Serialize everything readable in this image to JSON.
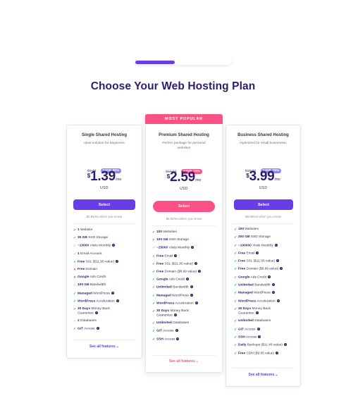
{
  "page_title": "Choose Your Web Hosting Plan",
  "plans": [
    {
      "name": "Single Shared Hosting",
      "description": "Ideal solution for beginners",
      "old_price": "$9.49",
      "save_badge": "SAVE 85%",
      "currency": "$",
      "price": "1.39",
      "per": "/mo",
      "currency_code": "USD",
      "select_label": "Select",
      "renew_text": "$2.99/mo when you renew",
      "see_all_label": "See all features",
      "features": [
        {
          "mark": "check",
          "bold": "1",
          "text": " Website",
          "info": false
        },
        {
          "mark": "check",
          "bold": "30 GB",
          "text": " SSD Storage",
          "info": false
        },
        {
          "mark": "warn",
          "bold": "~10000",
          "text": " Visits Monthly",
          "info": true
        },
        {
          "mark": "warn",
          "bold": "1",
          "text": " Email Account",
          "info": false
        },
        {
          "mark": "check",
          "bold": "Free",
          "text": " SSL ($11.95 value)",
          "info": true
        },
        {
          "mark": "cross",
          "bold": "Free",
          "text": " Domain",
          "info": false
        },
        {
          "mark": "cross",
          "bold": "Google",
          "text": " Ads Credit",
          "info": false
        },
        {
          "mark": "warn",
          "bold": "100 GB",
          "text": " Bandwidth",
          "info": false
        },
        {
          "mark": "check",
          "bold": "Managed",
          "text": " WordPress",
          "info": true
        },
        {
          "mark": "check",
          "bold": "WordPress",
          "text": " Acceleration",
          "info": true
        },
        {
          "mark": "check",
          "bold": "30 Days",
          "text": " Money Back",
          "text2": "Guarantee",
          "info": true
        },
        {
          "mark": "warn",
          "bold": "2",
          "text": " Databases",
          "info": false
        },
        {
          "mark": "check",
          "bold": "GIT",
          "text": " Access",
          "info": true
        }
      ]
    },
    {
      "ribbon": "MOST POPULAR",
      "name": "Premium Shared Hosting",
      "description": "Perfect package for personal websites",
      "old_price": "$10.59",
      "save_badge": "SAVE 75%",
      "currency": "$",
      "price": "2.59",
      "per": "/mo",
      "currency_code": "USD",
      "select_label": "Select",
      "renew_text": "$5.99/mo when you renew",
      "see_all_label": "See all features",
      "features": [
        {
          "mark": "check",
          "bold": "100",
          "text": " Websites",
          "info": false
        },
        {
          "mark": "check",
          "bold": "100 GB",
          "text": " SSD Storage",
          "info": false
        },
        {
          "mark": "warn",
          "bold": "~25000",
          "text": " Visits Monthly",
          "info": true
        },
        {
          "mark": "check",
          "bold": "Free",
          "text": " Email",
          "info": true
        },
        {
          "mark": "check",
          "bold": "Free",
          "text": " SSL ($11.95 value)",
          "info": true
        },
        {
          "mark": "check",
          "bold": "Free",
          "text": " Domain ($8.99 value)",
          "info": true
        },
        {
          "mark": "check",
          "bold": "Google",
          "text": " Ads Credit",
          "info": true
        },
        {
          "mark": "check",
          "bold": "Unlimited",
          "text": " Bandwidth",
          "info": true
        },
        {
          "mark": "check",
          "bold": "Managed",
          "text": " WordPress",
          "info": true
        },
        {
          "mark": "check",
          "bold": "WordPress",
          "text": " Acceleration",
          "info": true
        },
        {
          "mark": "check",
          "bold": "30 Days",
          "text": " Money Back",
          "text2": "Guarantee",
          "info": true
        },
        {
          "mark": "check",
          "bold": "Unlimited",
          "text": " Databases",
          "info": false
        },
        {
          "mark": "check",
          "bold": "GIT",
          "text": " Access",
          "info": true
        },
        {
          "mark": "check",
          "bold": "SSH",
          "text": " Access",
          "info": true
        }
      ]
    },
    {
      "name": "Business Shared Hosting",
      "description": "Optimized for small businesses",
      "old_price": "$18.99",
      "save_badge": "SAVE 75%",
      "currency": "$",
      "price": "3.99",
      "per": "/mo",
      "currency_code": "USD",
      "select_label": "Select",
      "renew_text": "$8.99/mo when you renew",
      "see_all_label": "See all features",
      "features": [
        {
          "mark": "check",
          "bold": "100",
          "text": " Websites",
          "info": false
        },
        {
          "mark": "check",
          "bold": "200 GB",
          "text": " SSD Storage",
          "info": false
        },
        {
          "mark": "check",
          "bold": "~100000",
          "text": " Visits Monthly",
          "info": true
        },
        {
          "mark": "check",
          "bold": "Free",
          "text": " Email",
          "info": true
        },
        {
          "mark": "check",
          "bold": "Free",
          "text": " SSL ($11.95 value)",
          "info": true
        },
        {
          "mark": "check",
          "bold": "Free",
          "text": " Domain ($8.99 value)",
          "info": true
        },
        {
          "mark": "check",
          "bold": "Google",
          "text": " Ads Credit",
          "info": true
        },
        {
          "mark": "check",
          "bold": "Unlimited",
          "text": " Bandwidth",
          "info": true
        },
        {
          "mark": "check",
          "bold": "Managed",
          "text": " WordPress",
          "info": true
        },
        {
          "mark": "check",
          "bold": "WordPress",
          "text": " Acceleration",
          "info": true
        },
        {
          "mark": "check",
          "bold": "30 Days",
          "text": " Money Back",
          "text2": "Guarantee",
          "info": true
        },
        {
          "mark": "check",
          "bold": "Unlimited",
          "text": " Databases",
          "info": false
        },
        {
          "mark": "check",
          "bold": "GIT",
          "text": " Access",
          "info": true
        },
        {
          "mark": "check",
          "bold": "SSH",
          "text": " Access",
          "info": true
        },
        {
          "mark": "check",
          "bold": "Daily",
          "text": " Backups ($11.40 value)",
          "info": true
        },
        {
          "mark": "check",
          "bold": "Free",
          "text": " CDN ($9.95 value)",
          "info": true
        }
      ]
    }
  ]
}
